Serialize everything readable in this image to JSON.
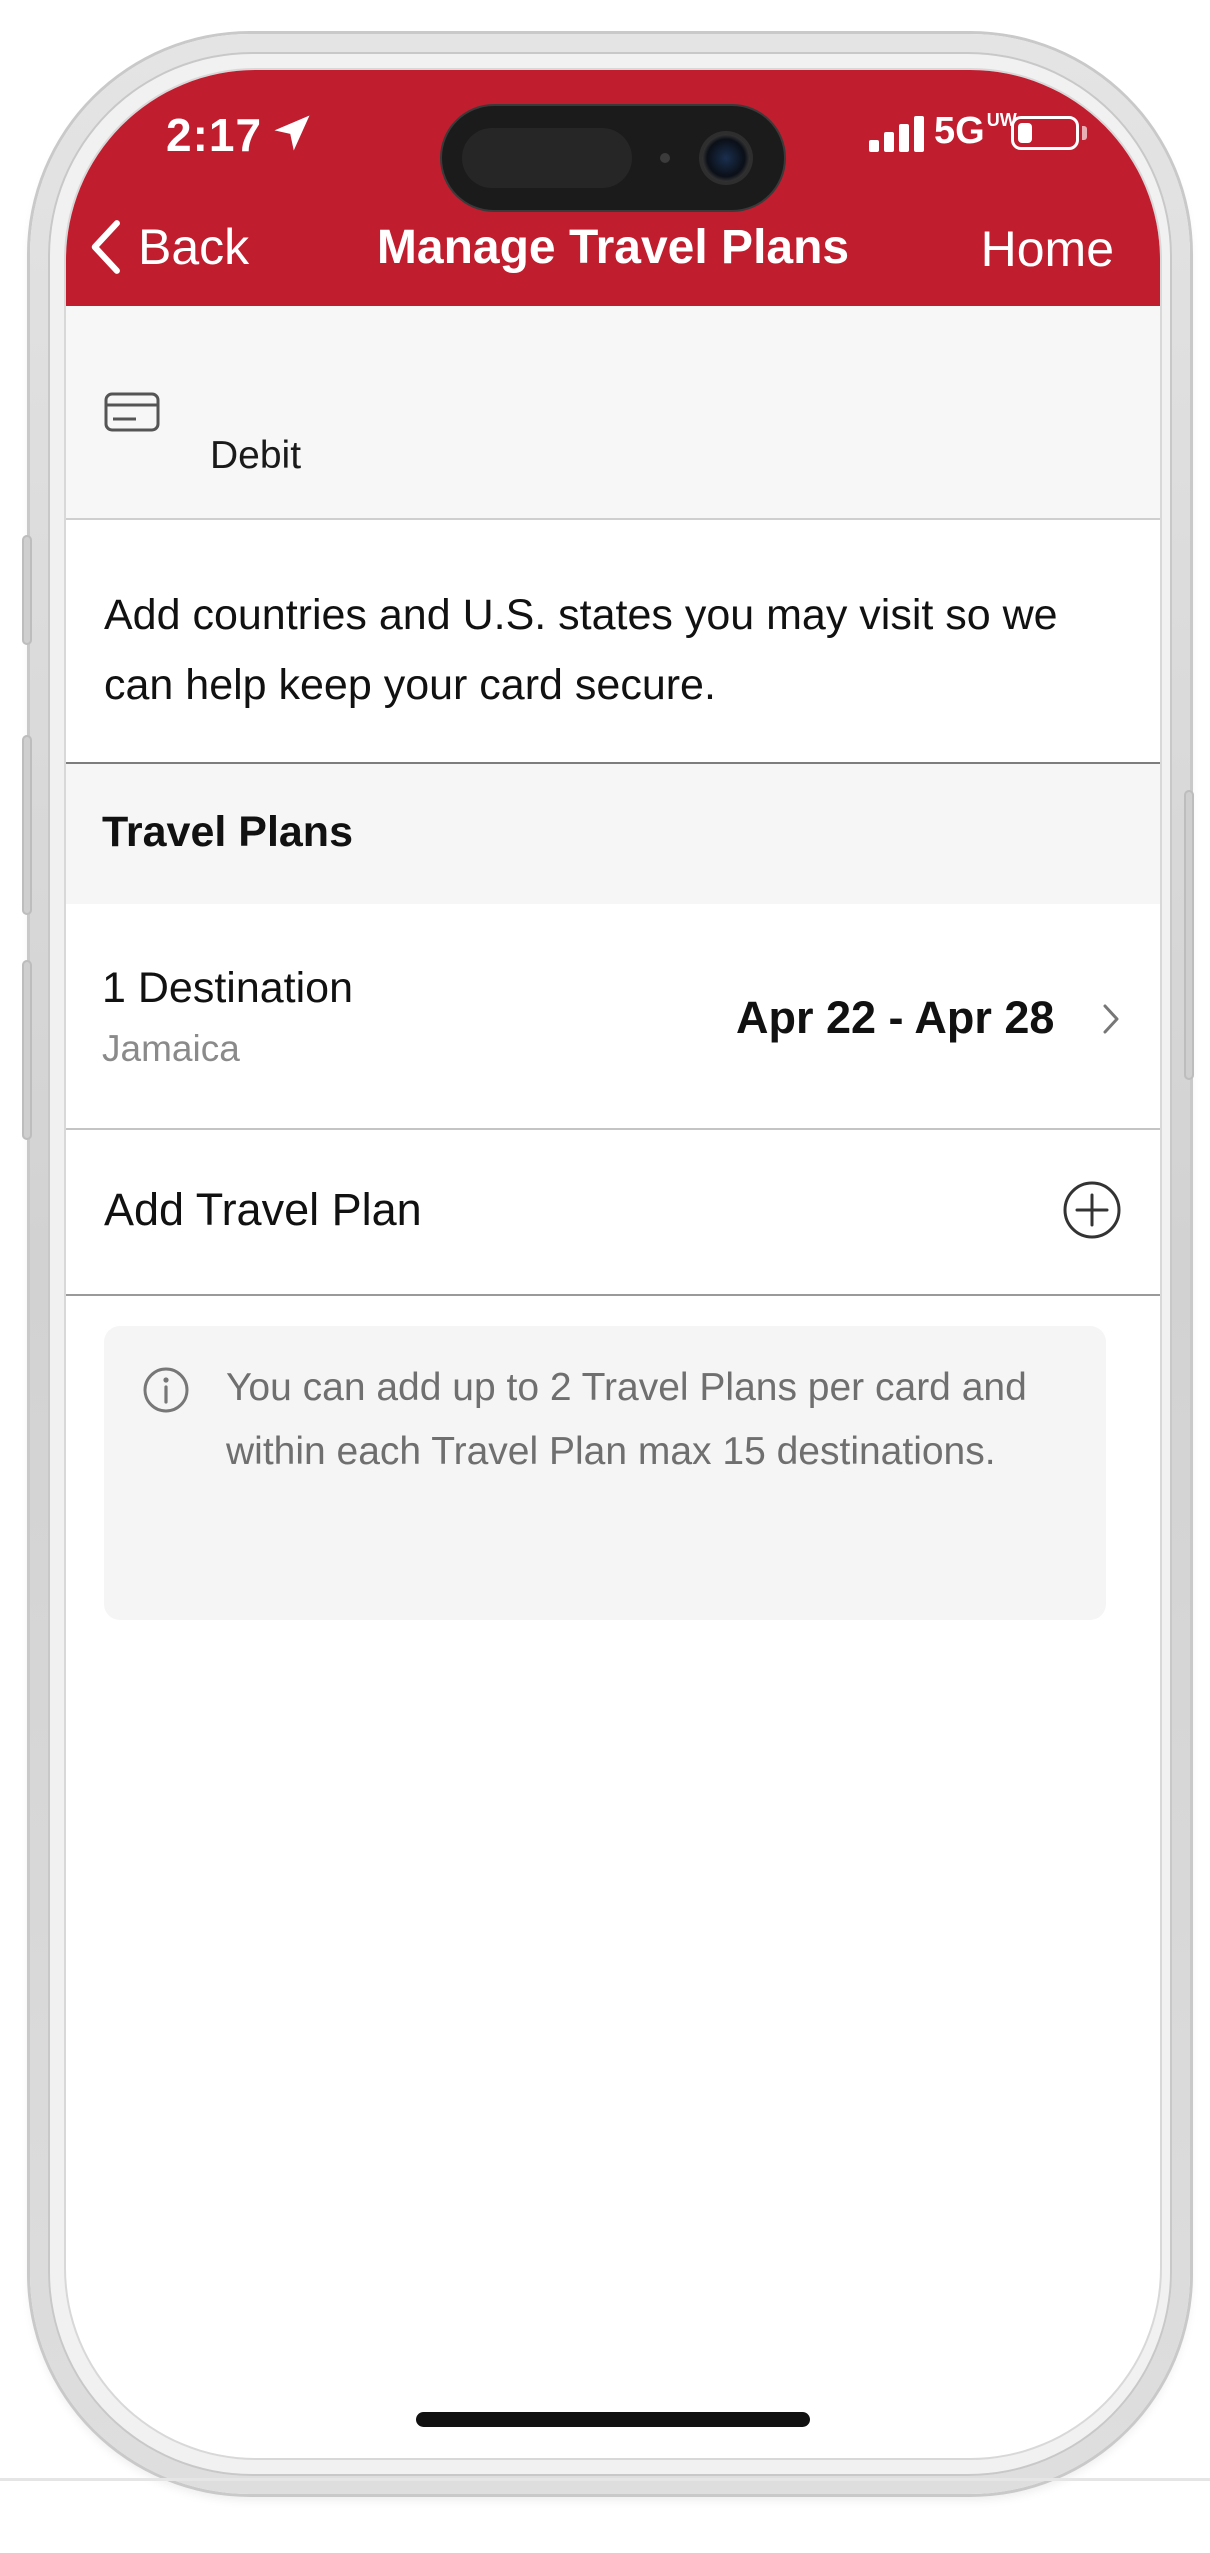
{
  "status_bar": {
    "time": "2:17",
    "network": "5G",
    "network_sup": "UW",
    "icons": [
      "location-arrow-icon",
      "signal-bars-icon",
      "battery-icon"
    ]
  },
  "nav": {
    "back_label": "Back",
    "title": "Manage Travel Plans",
    "home_label": "Home"
  },
  "card": {
    "icon": "credit-card-icon",
    "label": "Debit"
  },
  "description": "Add countries and U.S. states you may visit so we can help keep your card secure.",
  "section": {
    "title": "Travel Plans"
  },
  "travel_plans": [
    {
      "destination_count": "1 Destination",
      "destinations": "Jamaica",
      "dates": "Apr 22 - Apr 28"
    }
  ],
  "add_plan": {
    "label": "Add Travel Plan",
    "icon": "add-circle-icon"
  },
  "info": {
    "icon": "info-icon",
    "text": "You can add up to 2 Travel Plans per card and within each Travel Plan max 15 destinations."
  },
  "colors": {
    "header_red": "#c01d2f",
    "panel_gray": "#f7f7f7",
    "secondary_text": "#8a8a8a"
  }
}
